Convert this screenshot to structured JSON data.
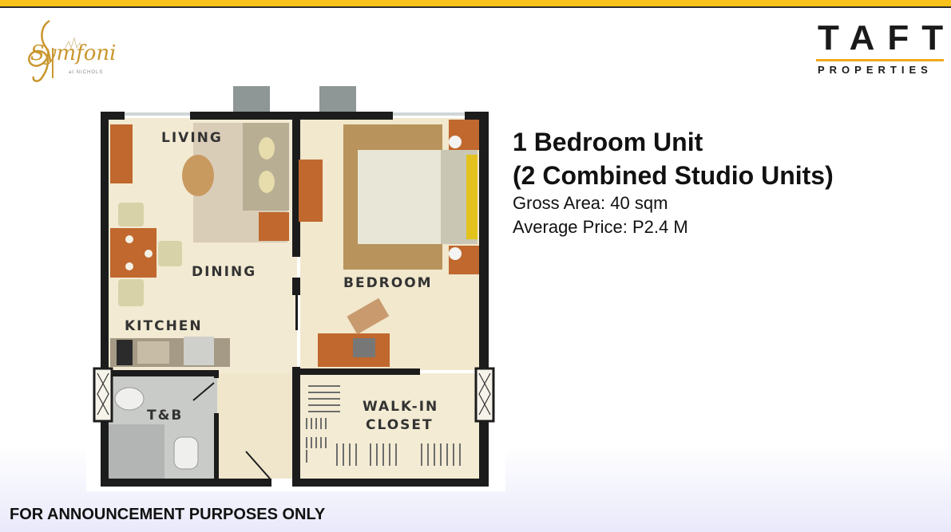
{
  "header": {
    "developer_logo": "TAFT",
    "developer_logo_sub": "PROPERTIES",
    "project_logo": "Symfoni",
    "project_logo_sub": "at NICHOLS",
    "accent_color": "#f7c21a"
  },
  "unit": {
    "title": "1 Bedroom Unit",
    "subtitle": "(2 Combined Studio Units)",
    "gross_area": "Gross Area: 40 sqm",
    "average_price": "Average Price: P2.4 M"
  },
  "floor_plan": {
    "rooms": {
      "living": "LIVING",
      "dining": "DINING",
      "kitchen": "KITCHEN",
      "bedroom": "BEDROOM",
      "tb": "T&B",
      "closet_line1": "WALK-IN",
      "closet_line2": "CLOSET"
    }
  },
  "footer": {
    "notice": "FOR ANNOUNCEMENT PURPOSES ONLY"
  }
}
